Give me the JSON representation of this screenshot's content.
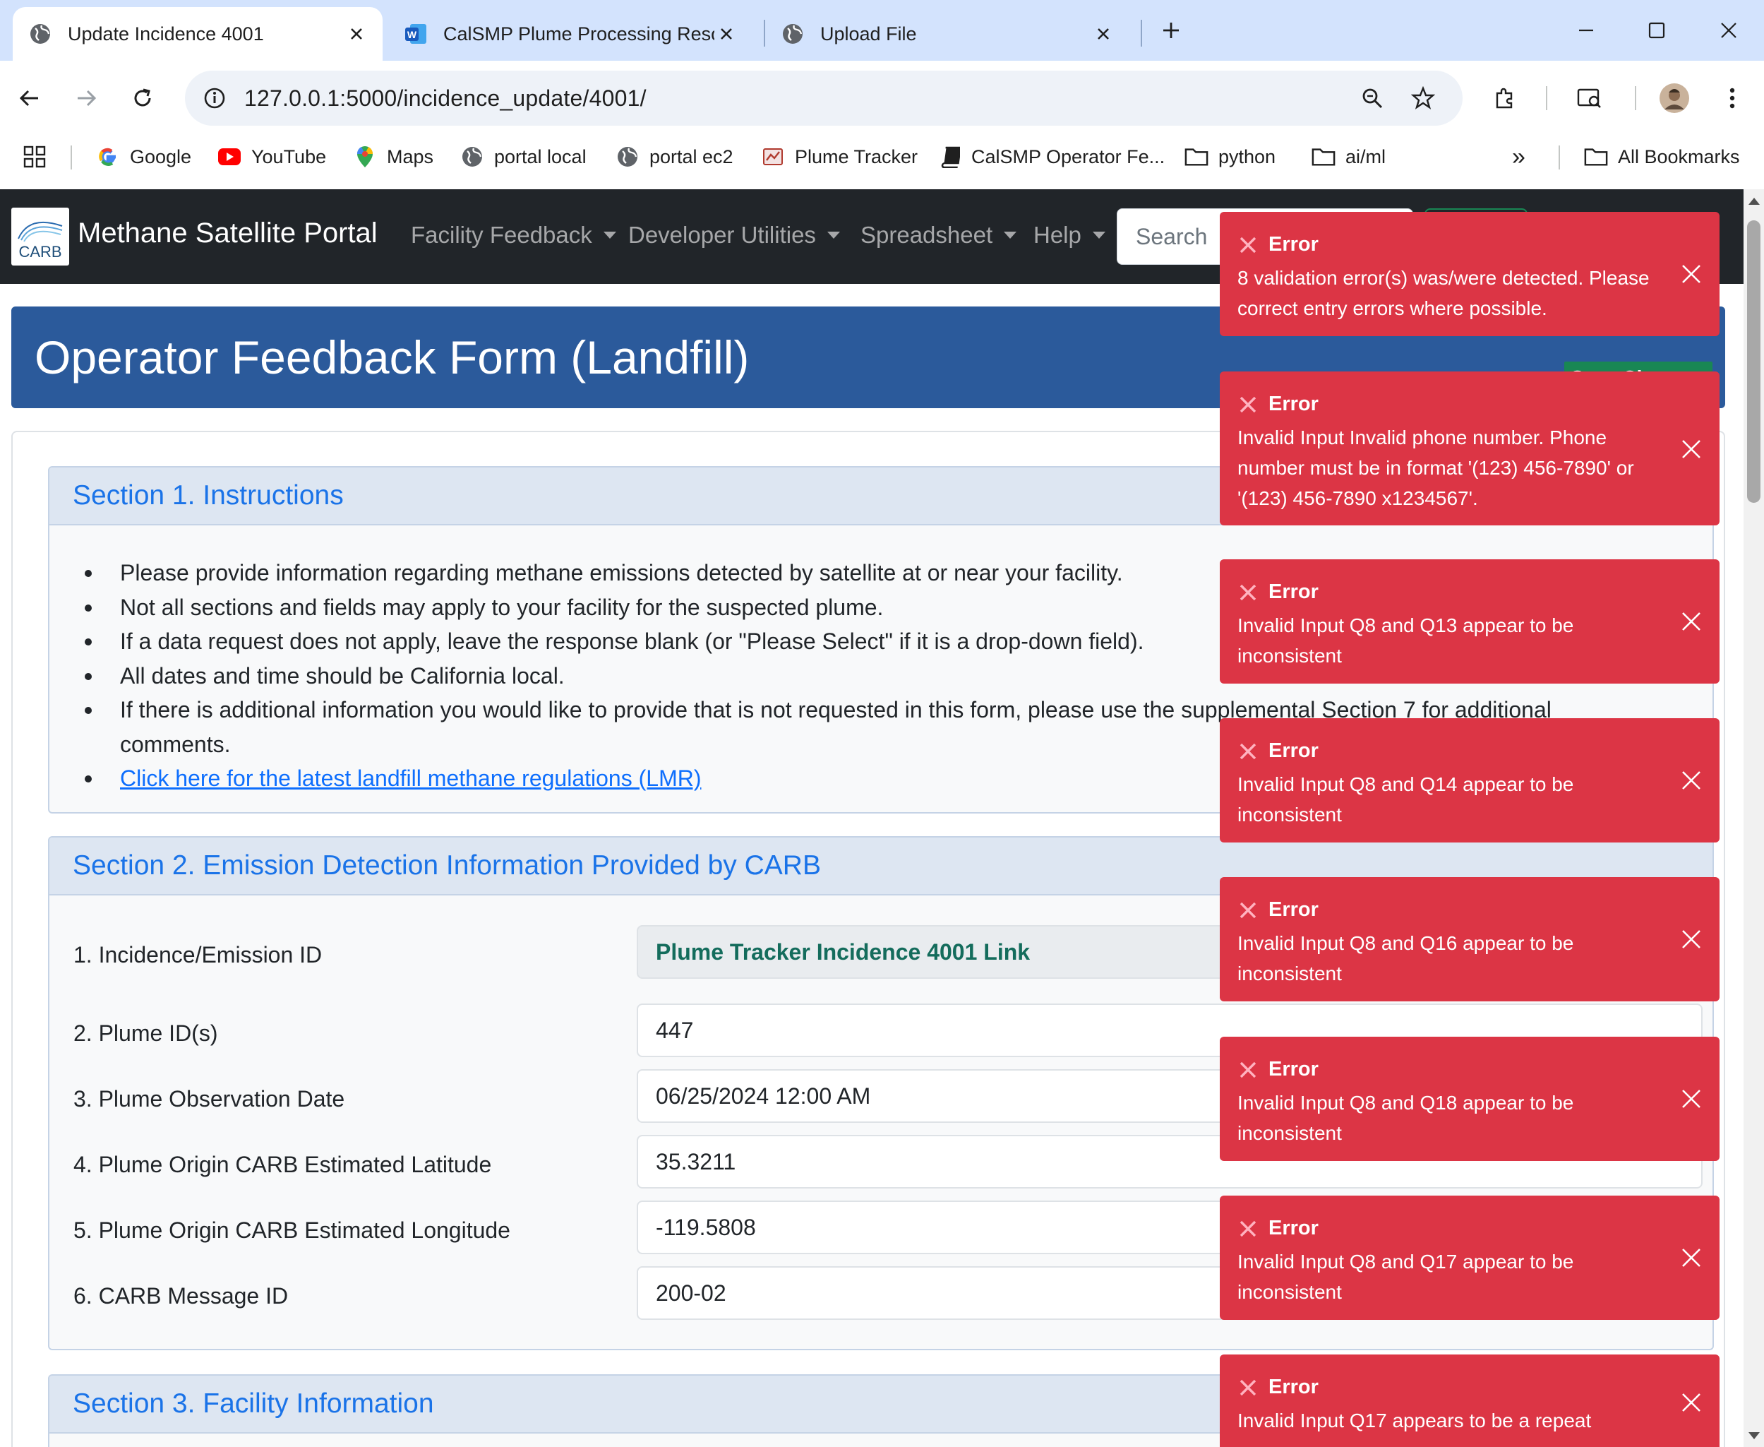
{
  "browser": {
    "tabs": [
      {
        "title": "Update Incidence 4001",
        "active": true
      },
      {
        "title": "CalSMP Plume Processing Reso",
        "active": false
      },
      {
        "title": "Upload File",
        "active": false
      }
    ],
    "url": "127.0.0.1:5000/incidence_update/4001/",
    "bookmarks": [
      "Google",
      "YouTube",
      "Maps",
      "portal local",
      "portal ec2",
      "Plume Tracker",
      "CalSMP Operator Fe...",
      "python",
      "ai/ml"
    ],
    "all_bookmarks_label": "All Bookmarks",
    "more_bookmarks_label": "»"
  },
  "navbar": {
    "logo_text": "CARB",
    "brand": "Methane Satellite Portal",
    "items": [
      "Facility Feedback",
      "Developer Utilities",
      "Spreadsheet",
      "Help"
    ],
    "search_placeholder": "Search"
  },
  "form": {
    "title": "Operator Feedback Form (Landfill)",
    "save_label": "Save Changes",
    "section1": {
      "heading": "Section 1. Instructions",
      "items": [
        "Please provide information regarding methane emissions detected by satellite at or near your facility.",
        "Not all sections and fields may apply to your facility for the suspected plume.",
        "If a data request does not apply, leave the response blank (or \"Please Select\" if it is a drop-down field).",
        "All dates and time should be California local.",
        "If there is additional information you would like to provide that is not requested in this form, please use the supplemental Section 7 for additional comments."
      ],
      "link": "Click here for the latest landfill methane regulations (LMR)"
    },
    "section2": {
      "heading": "Section 2. Emission Detection Information Provided by CARB",
      "rows": [
        {
          "label": "1. Incidence/Emission ID",
          "value": "Plume Tracker Incidence 4001 Link"
        },
        {
          "label": "2. Plume ID(s)",
          "value": "447"
        },
        {
          "label": "3. Plume Observation Date",
          "value": "06/25/2024 12:00  AM"
        },
        {
          "label": "4. Plume Origin CARB Estimated Latitude",
          "value": "35.3211"
        },
        {
          "label": "5. Plume Origin CARB Estimated Longitude",
          "value": "-119.5808"
        },
        {
          "label": "6. CARB Message ID",
          "value": "200-02"
        }
      ]
    },
    "section3": {
      "heading": "Section 3. Facility Information"
    }
  },
  "toasts": [
    {
      "title": "Error",
      "message": "8 validation error(s) was/were detected. Please correct entry errors where possible."
    },
    {
      "title": "Error",
      "message": "Invalid Input Invalid phone number. Phone number must be in format '(123) 456-7890' or '(123) 456-7890 x1234567'."
    },
    {
      "title": "Error",
      "message": "Invalid Input Q8 and Q13 appear to be inconsistent"
    },
    {
      "title": "Error",
      "message": "Invalid Input Q8 and Q14 appear to be inconsistent"
    },
    {
      "title": "Error",
      "message": "Invalid Input Q8 and Q16 appear to be inconsistent"
    },
    {
      "title": "Error",
      "message": "Invalid Input Q8 and Q18 appear to be inconsistent"
    },
    {
      "title": "Error",
      "message": "Invalid Input Q8 and Q17 appear to be inconsistent"
    },
    {
      "title": "Error",
      "message": "Invalid Input Q17 appears to be a repeat"
    }
  ],
  "colors": {
    "tab_strip": "#d3e3fd",
    "navbar": "#212529",
    "form_header": "#2b5a9b",
    "save_button": "#198754",
    "toast_error": "#dc3545",
    "section_heading_text": "#1a73e8"
  }
}
